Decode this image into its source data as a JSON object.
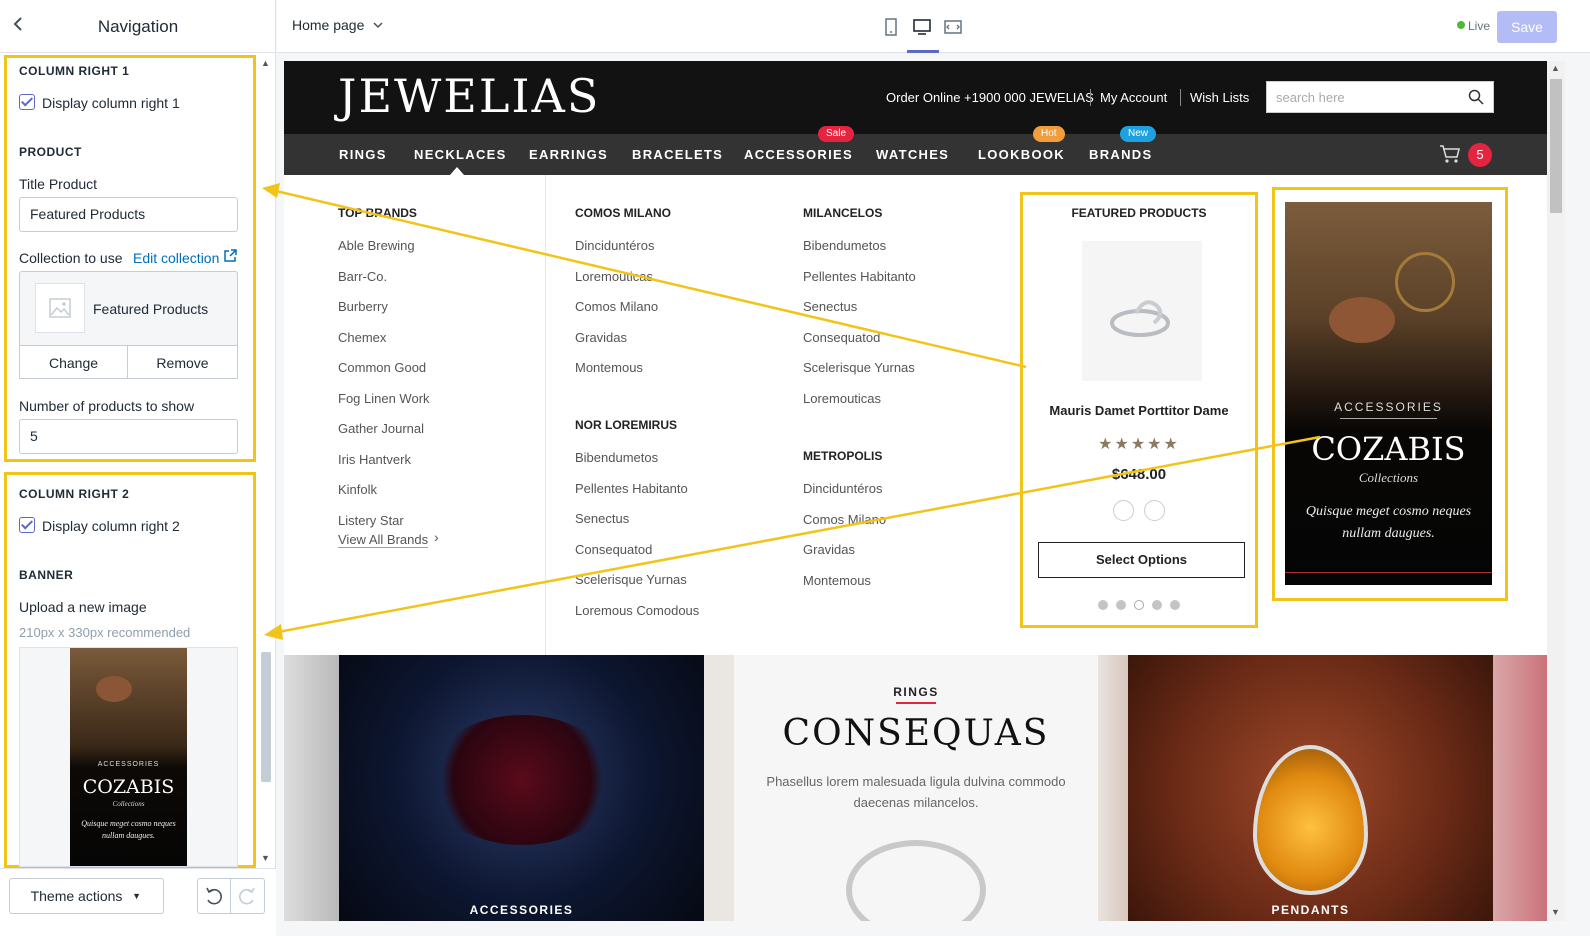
{
  "sidebar": {
    "title": "Navigation",
    "back_icon": "chevron-left-icon",
    "column_right_1": {
      "heading": "COLUMN RIGHT 1",
      "checkbox_label": "Display column right 1",
      "checked": true,
      "product_heading": "PRODUCT",
      "title_label": "Title Product",
      "title_value": "Featured Products",
      "collection_label": "Collection to use",
      "edit_collection": "Edit collection",
      "collection_name": "Featured Products",
      "change_label": "Change",
      "remove_label": "Remove",
      "count_label": "Number of products to show",
      "count_value": "5"
    },
    "column_right_2": {
      "heading": "COLUMN RIGHT 2",
      "checkbox_label": "Display column right 2",
      "checked": true,
      "banner_heading": "BANNER",
      "upload_label": "Upload a new image",
      "recommend": "210px x 330px recommended",
      "thumb_tag": "ACCESSORIES",
      "thumb_title": "COZABIS",
      "thumb_sub": "Collections",
      "thumb_text": "Quisque meget cosmo neques nullam daugues."
    },
    "footer": {
      "theme_actions": "Theme actions"
    }
  },
  "topbar": {
    "page_select": "Home page",
    "live_label": "Live",
    "save_label": "Save",
    "live_color": "#50b83c"
  },
  "site": {
    "logo": "JEWELIAS",
    "order_online": "Order Online +1900 000 JEWELIAS",
    "my_account": "My Account",
    "wish_lists": "Wish Lists",
    "search_placeholder": "search here",
    "cart_count": "5",
    "menu": [
      "RINGS",
      "NECKLACES",
      "EARRINGS",
      "BRACELETS",
      "ACCESSORIES",
      "WATCHES",
      "LOOKBOOK",
      "BRANDS"
    ],
    "badges": {
      "sale": "Sale",
      "hot": "Hot",
      "new": "New"
    },
    "mega": {
      "top_brands": {
        "heading": "TOP BRANDS",
        "items": [
          "Able Brewing",
          "Barr-Co.",
          "Burberry",
          "Chemex",
          "Common Good",
          "Fog Linen Work",
          "Gather Journal",
          "Iris Hantverk",
          "Kinfolk",
          "Listery Star"
        ],
        "view_all": "View All Brands"
      },
      "comos_milano": {
        "heading": "COMOS MILANO",
        "items": [
          "Dinciduntéros",
          "Loremouticas",
          "Comos Milano",
          "Gravidas",
          "Montemous"
        ]
      },
      "nor_loremirus": {
        "heading": "NOR LOREMIRUS",
        "items": [
          "Bibendumetos",
          "Pellentes Habitanto",
          "Senectus",
          "Consequatod",
          "Scelerisque Yurnas",
          "Loremous Comodous"
        ]
      },
      "milancelos": {
        "heading": "MILANCELOS",
        "items": [
          "Bibendumetos",
          "Pellentes Habitanto",
          "Senectus",
          "Consequatod",
          "Scelerisque Yurnas",
          "Loremouticas"
        ]
      },
      "metropolis": {
        "heading": "METROPOLIS",
        "items": [
          "Dinciduntéros",
          "Comos Milano",
          "Gravidas",
          "Montemous"
        ]
      },
      "featured": {
        "heading": "FEATURED PRODUCTS",
        "product_name": "Mauris Damet Porttitor Dame",
        "rating": 5,
        "price": "$648.00",
        "button": "Select Options",
        "dots": 5,
        "active_dot": 3
      },
      "banner": {
        "tag": "ACCESSORIES",
        "title": "COZABIS",
        "sub": "Collections",
        "text": "Quisque meget cosmo neques nullam daugues."
      }
    },
    "tiles": {
      "left_label": "ACCESSORIES",
      "center_tag": "RINGS",
      "center_title": "CONSEQUAS",
      "center_text": "Phasellus lorem malesuada ligula dulvina commodo daecenas milancelos.",
      "right_label": "PENDANTS"
    }
  },
  "colors": {
    "highlight": "#f0c419",
    "accent": "#5c6ac4",
    "sale": "#e5243f",
    "hot": "#f39c3c",
    "new": "#1ea1e0",
    "cart_badge": "#e5243f"
  }
}
